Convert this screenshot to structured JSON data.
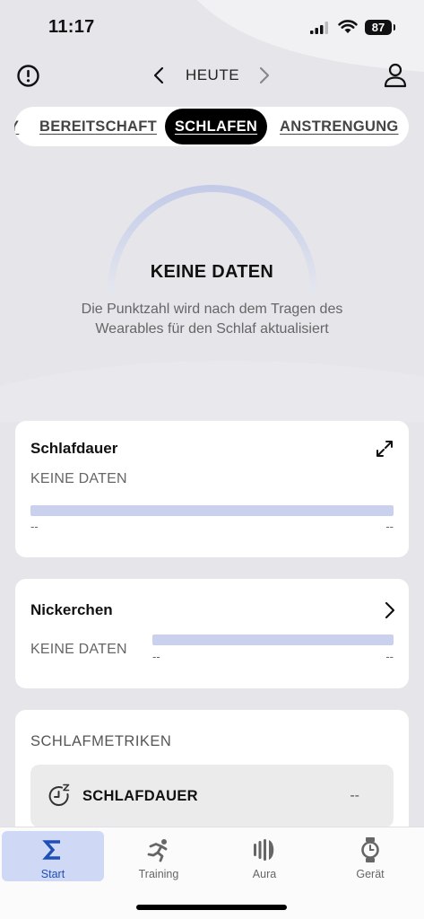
{
  "status_bar": {
    "time": "11:17",
    "battery": "87",
    "icons": [
      "signal-icon",
      "wifi-icon",
      "battery-icon"
    ]
  },
  "header": {
    "date_label": "HEUTE",
    "icons": [
      "alert-icon",
      "chevron-left-icon",
      "chevron-right-icon",
      "profile-icon"
    ]
  },
  "tabs": [
    {
      "label": "BEREITSCHAFT",
      "active": false
    },
    {
      "label": "SCHLAFEN",
      "active": true
    },
    {
      "label": "ANSTRENGUNG",
      "active": false
    }
  ],
  "score": {
    "title": "KEINE DATEN",
    "subtitle": "Die Punktzahl wird nach dem Tragen des Wearables für den Schlaf aktualisiert"
  },
  "cards": {
    "sleep_duration": {
      "title": "Schlafdauer",
      "value": "KEINE DATEN",
      "left_dash": "--",
      "right_dash": "--"
    },
    "naps": {
      "title": "Nickerchen",
      "value": "KEINE DATEN",
      "left_dash": "--",
      "right_dash": "--"
    },
    "metrics": {
      "heading": "SCHLAFMETRIKEN",
      "rows": [
        {
          "label": "SCHLAFDAUER",
          "value": "--",
          "icon": "sleep-timer-icon"
        }
      ]
    }
  },
  "bottom_nav": [
    {
      "label": "Start",
      "icon": "sigma-icon",
      "active": true
    },
    {
      "label": "Training",
      "icon": "runner-icon",
      "active": false
    },
    {
      "label": "Aura",
      "icon": "aura-icon",
      "active": false
    },
    {
      "label": "Gerät",
      "icon": "watch-icon",
      "active": false
    }
  ],
  "colors": {
    "background": "#e6e6ea",
    "accent": "#1f4fb5",
    "active_nav_bg": "#cfd9f5",
    "bar": "#c9d1ef"
  }
}
